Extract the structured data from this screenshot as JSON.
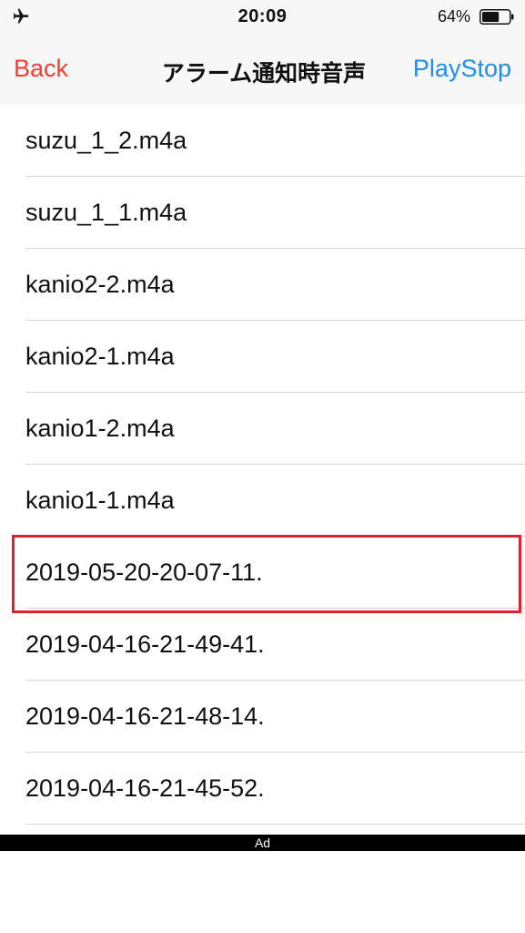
{
  "status_bar": {
    "time": "20:09",
    "battery_percent": "64%",
    "battery_level": 0.64,
    "airplane_icon": "airplane-icon",
    "battery_icon": "battery-icon"
  },
  "nav": {
    "back_label": "Back",
    "title": "アラーム通知時音声",
    "action_label": "PlayStop",
    "back_color": "#ff3b30",
    "action_color": "#1e8cf0"
  },
  "files": [
    "suzu_1_2.m4a",
    "suzu_1_1.m4a",
    "kanio2-2.m4a",
    "kanio2-1.m4a",
    "kanio1-2.m4a",
    "kanio1-1.m4a",
    "2019-05-20-20-07-11.",
    "2019-04-16-21-49-41.",
    "2019-04-16-21-48-14.",
    "2019-04-16-21-45-52."
  ],
  "highlight_color": "#e0202c",
  "ad": {
    "label": "Ad"
  }
}
